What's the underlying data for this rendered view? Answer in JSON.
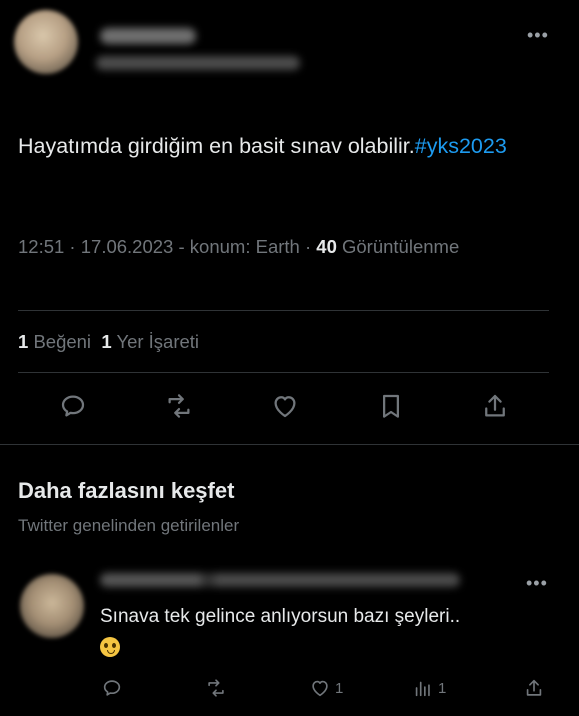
{
  "tweet": {
    "text": "Hayatımda girdiğim en basit sınav olabilir.",
    "hashtag": "#yks2023",
    "time": "12:51",
    "date": "17.06.2023",
    "location": "konum: Earth",
    "views_count": "40",
    "views_label": "Görüntülenme",
    "likes_count": "1",
    "likes_label": "Beğeni",
    "bookmarks_count": "1",
    "bookmarks_label": "Yer İşareti"
  },
  "icons": {
    "reply": "reply-icon",
    "retweet": "retweet-icon",
    "like": "heart-icon",
    "bookmark": "bookmark-icon",
    "share": "share-icon",
    "more": "more-icon",
    "views": "views-icon"
  },
  "discover": {
    "title": "Daha fazlasını keşfet",
    "subtitle": "Twitter genelinden getirilenler"
  },
  "reply_tweet": {
    "text": "Sınava tek gelince anlıyorsun bazı şeyleri..",
    "like_count": "1",
    "view_count": "1"
  },
  "colors": {
    "background": "#000000",
    "text": "#e7e9ea",
    "muted": "#71767b",
    "accent": "#1d9bf0",
    "divider": "#2f3336"
  }
}
